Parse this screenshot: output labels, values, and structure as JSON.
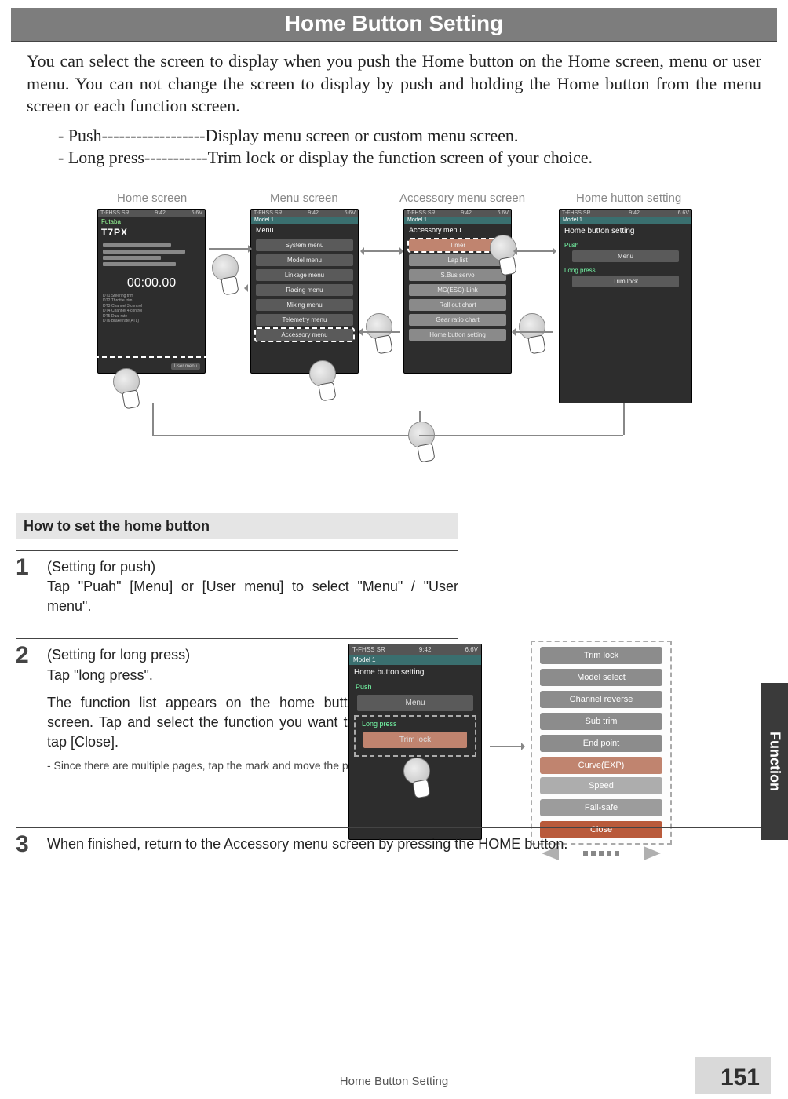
{
  "title": "Home Button Setting",
  "intro_text": "You can select the screen to display when you push the Home button on the Home screen, menu or user menu. You can not change the screen to display by push and holding the Home button from the menu screen or each function screen.",
  "bullets": [
    "- Push------------------Display menu screen or custom menu screen.",
    "- Long press-----------Trim lock or display the function screen of your choice."
  ],
  "diagram": {
    "labels": {
      "home": "Home screen",
      "menu": "Menu screen",
      "accessory": "Accessory menu screen",
      "setting": "Home hutton setting"
    },
    "status": {
      "left": "T-FHSS SR",
      "center": "9:42",
      "right": "6.6V"
    },
    "model": "Model 1",
    "home": {
      "brand": "Futaba",
      "model_line": "T7PX",
      "timer": "00:00.00",
      "list": [
        "DT1 Steering trim",
        "DT2 Throttle trim",
        "DT3 Channel 3 control",
        "DT4 Channel 4 control",
        "DT5 Dual rate",
        "DT6 Brake rate(ATL)"
      ]
    },
    "menu": {
      "header": "Menu",
      "items": [
        "System menu",
        "Model menu",
        "Linkage menu",
        "Racing menu",
        "Mixing menu",
        "Telemetry menu",
        "Accessory menu"
      ]
    },
    "accessory": {
      "header": "Accessory menu",
      "items": [
        "Timer",
        "Lap list",
        "S.Bus servo",
        "MC(ESC)-Link",
        "Roll out chart",
        "Gear ratio chart",
        "Home button setting"
      ]
    },
    "setting": {
      "header": "Home button setting",
      "push_label": "Push",
      "push_value": "Menu",
      "long_label": "Long press",
      "long_value": "Trim lock"
    }
  },
  "howto": {
    "header": "How to set the home button",
    "step1": {
      "num": "1",
      "title": "(Setting for push)",
      "body": "Tap \"Puah\" [Menu] or [User menu] to select \"Menu\" / \"User menu\"."
    },
    "step2": {
      "num": "2",
      "title": "(Setting for long press)",
      "line1": "Tap \"long press\".",
      "body": "The function list appears on the home button setting menu screen. Tap and select the function you want to use. To cancel, tap [Close].",
      "note": "- Since there are multiple pages, tap the    mark and move the page."
    },
    "step3": {
      "num": "3",
      "body": "When finished, return to the Accessory menu screen by pressing the HOME button."
    }
  },
  "step2_screen": {
    "header": "Home button setting",
    "push_label": "Push",
    "push_value": "Menu",
    "long_label": "Long press",
    "long_value": "Trim lock"
  },
  "function_list": [
    "Trim lock",
    "Model select",
    "Channel reverse",
    "Sub trim",
    "End point",
    "Curve(EXP)",
    "Speed",
    "Fail-safe"
  ],
  "function_close": "Close",
  "footer_title": "Home Button Setting",
  "page_number": "151",
  "side_tab": "Function"
}
